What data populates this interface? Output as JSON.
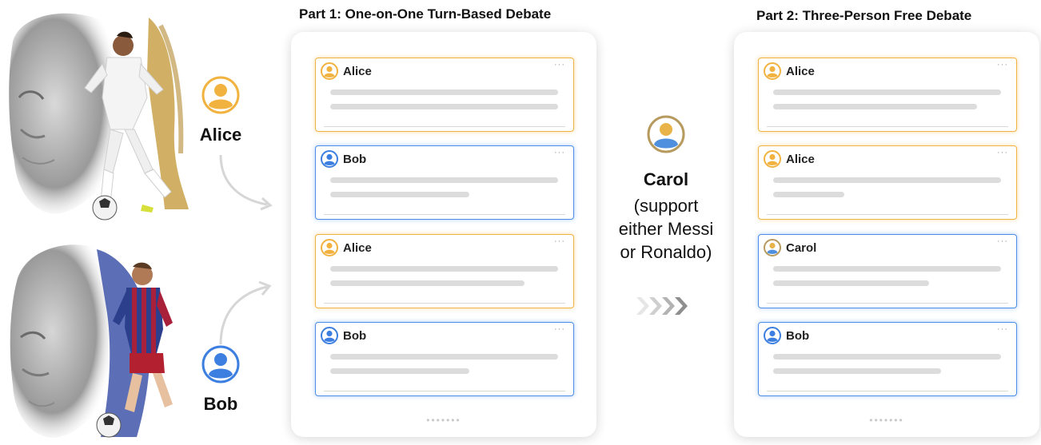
{
  "personas": {
    "alice": {
      "name": "Alice",
      "color": "#f2b240"
    },
    "bob": {
      "name": "Bob",
      "color": "#3d7fe0"
    },
    "carol": {
      "name": "Carol",
      "note": "(support either Messi or Ronaldo)",
      "note_lines": [
        "(support",
        "either Messi",
        "or Ronaldo)"
      ]
    }
  },
  "part1": {
    "title": "Part 1: One-on-One Turn-Based Debate",
    "messages": [
      {
        "speaker": "Alice",
        "style": "orange",
        "icon": "alice-avatar-icon"
      },
      {
        "speaker": "Bob",
        "style": "blue",
        "icon": "bob-avatar-icon"
      },
      {
        "speaker": "Alice",
        "style": "orange",
        "icon": "alice-avatar-icon"
      },
      {
        "speaker": "Bob",
        "style": "blue",
        "icon": "bob-avatar-icon"
      }
    ]
  },
  "part2": {
    "title": "Part 2: Three-Person Free Debate",
    "messages": [
      {
        "speaker": "Alice",
        "style": "orange",
        "icon": "alice-avatar-icon"
      },
      {
        "speaker": "Alice",
        "style": "orange",
        "icon": "alice-avatar-icon"
      },
      {
        "speaker": "Carol",
        "style": "blue",
        "icon": "carol-avatar-icon"
      },
      {
        "speaker": "Bob",
        "style": "blue",
        "icon": "bob-avatar-icon"
      }
    ]
  },
  "colors": {
    "orange_border": "#f2b240",
    "blue_border": "#4a8ee8",
    "placeholder_line": "#dcdcdc"
  },
  "icons": [
    "ronaldo-portrait-image",
    "messi-portrait-image",
    "curved-arrow-icon",
    "chevron-arrows-icon",
    "more-dots-icon"
  ]
}
